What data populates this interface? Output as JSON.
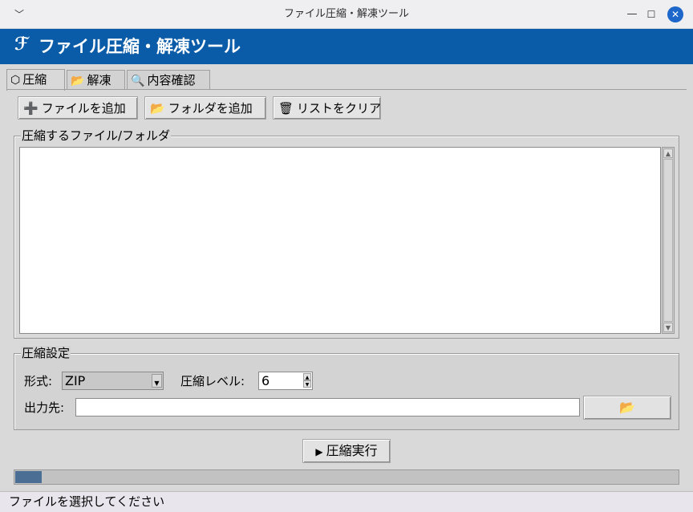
{
  "window": {
    "title": "ファイル圧縮・解凍ツール",
    "menu_icon": "chevron-down-icon",
    "minimize_icon": "minimize-icon",
    "maximize_icon": "maximize-icon",
    "close_icon": "close-icon"
  },
  "header": {
    "logo": "ℱ",
    "title": "ファイル圧縮・解凍ツール",
    "background": "#0b5ca8"
  },
  "tabs": [
    {
      "icon": "box-icon",
      "glyph": "⬡",
      "label": "圧縮",
      "active": true
    },
    {
      "icon": "folder-icon",
      "glyph": "📂",
      "label": "解凍",
      "active": false
    },
    {
      "icon": "magnifier-icon",
      "glyph": "🔍",
      "label": "内容確認",
      "active": false
    }
  ],
  "toolbar": {
    "add_file": {
      "icon": "plus-icon",
      "glyph": "➕",
      "label": "ファイルを追加"
    },
    "add_folder": {
      "icon": "folder-icon",
      "glyph": "📂",
      "label": "フォルダを追加"
    },
    "clear_list": {
      "icon": "trash-icon",
      "glyph": "🗑",
      "label": "リストをクリア"
    }
  },
  "files_section": {
    "title": "圧縮するファイル/フォルダ",
    "items": []
  },
  "settings": {
    "title": "圧縮設定",
    "format_label": "形式:",
    "format_value": "ZIP",
    "level_label": "圧縮レベル:",
    "level_value": "6",
    "output_label": "出力先:",
    "output_value": "",
    "browse_icon": "📂"
  },
  "run_button": {
    "glyph": "▶",
    "label": "圧縮実行"
  },
  "progress": {
    "percent": 4,
    "color": "#4a6e94"
  },
  "status": "ファイルを選択してください"
}
